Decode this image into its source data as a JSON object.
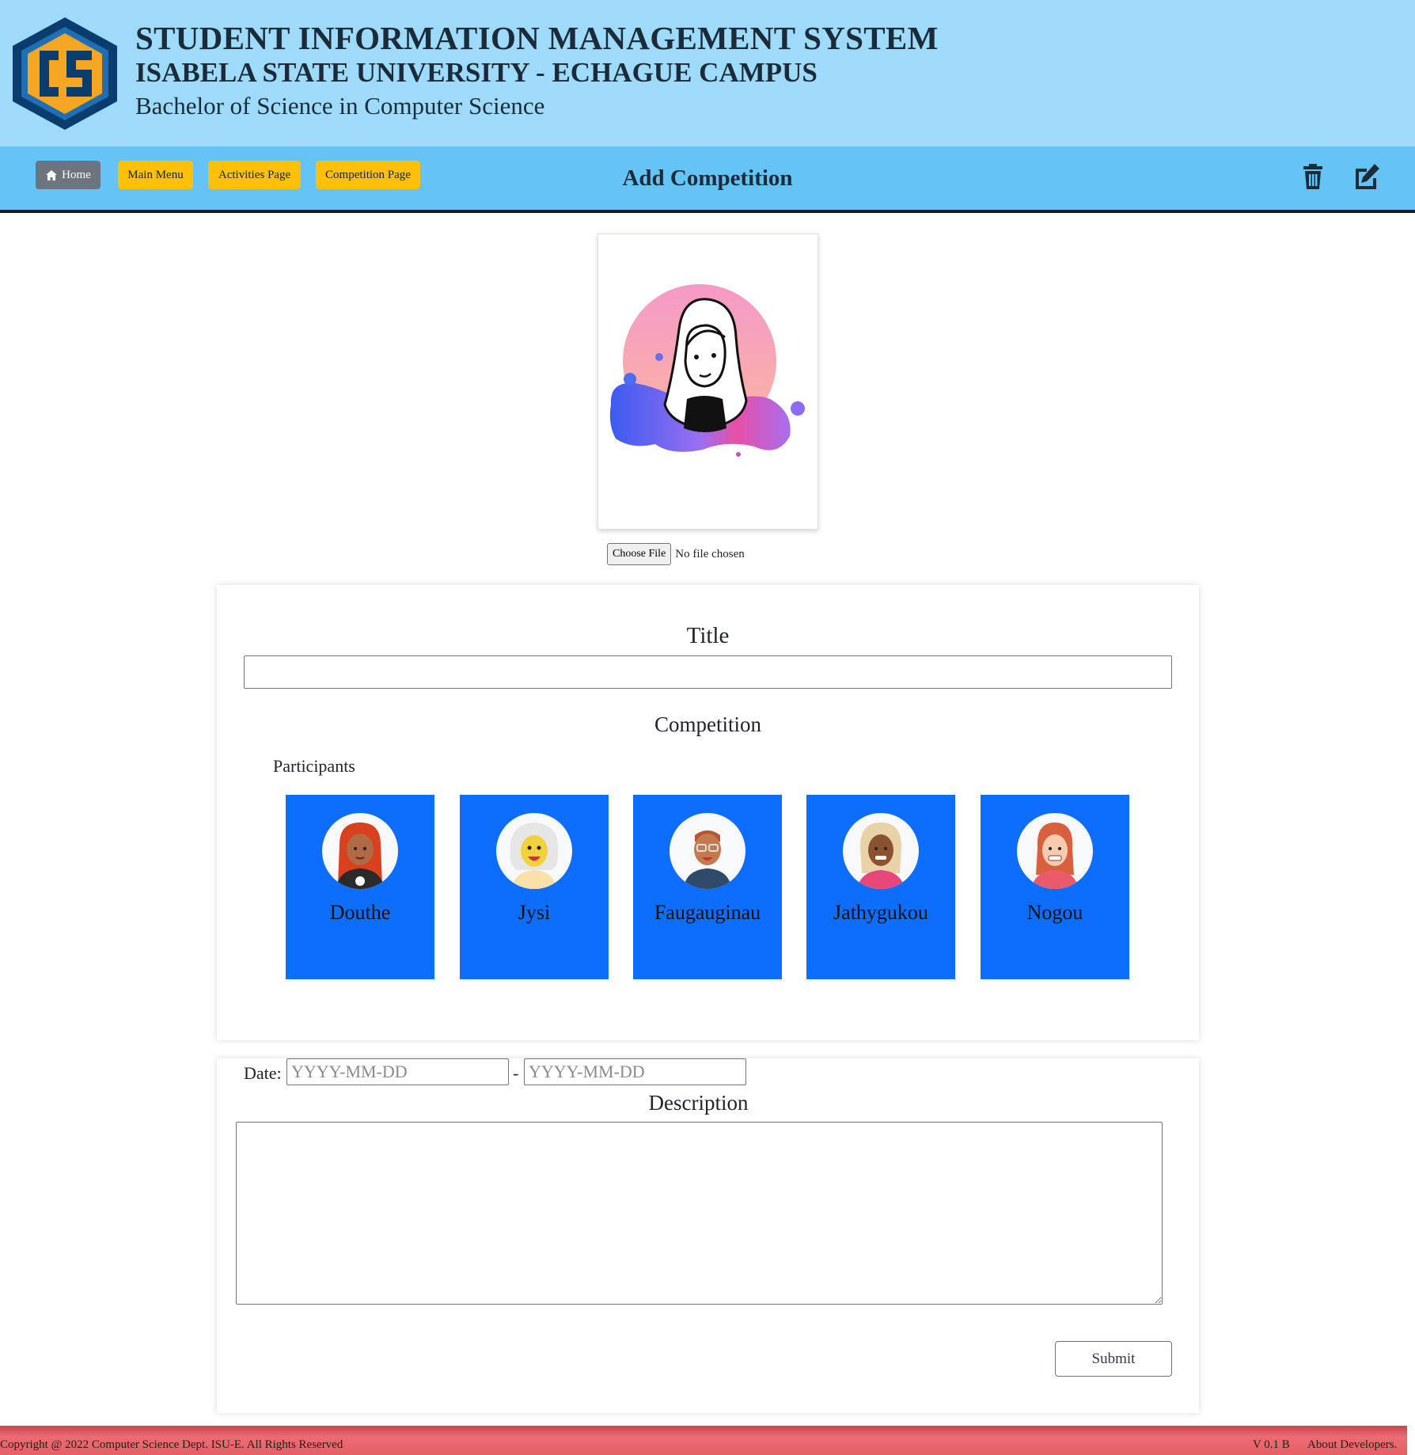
{
  "header": {
    "title": "STUDENT INFORMATION MANAGEMENT SYSTEM",
    "university": "ISABELA STATE UNIVERSITY - ECHAGUE CAMPUS",
    "program": "Bachelor of Science in Computer Science",
    "logo_icon": "cs-hexagon-logo"
  },
  "nav": {
    "home_label": "Home",
    "main_menu_label": "Main Menu",
    "activities_label": "Activities Page",
    "competition_label": "Competition Page",
    "page_title": "Add Competition",
    "delete_icon": "trash-icon",
    "edit_icon": "edit-icon"
  },
  "upload": {
    "choose_file_label": "Choose File",
    "file_status": "No file chosen"
  },
  "form": {
    "title_label": "Title",
    "title_value": "",
    "competition_label": "Competition",
    "participants_label": "Participants",
    "participants": [
      {
        "name": "Douthe"
      },
      {
        "name": "Jysi"
      },
      {
        "name": "Faugauginau"
      },
      {
        "name": "Jathygukou"
      },
      {
        "name": "Nogou"
      }
    ],
    "date_label": "Date:",
    "date_separator": "-",
    "date_from_placeholder": "YYYY-MM-DD",
    "date_to_placeholder": "YYYY-MM-DD",
    "description_label": "Description",
    "description_value": "",
    "submit_label": "Submit"
  },
  "footer": {
    "copyright": "Copyright @ 2022 Computer Science Dept. ISU-E. All Rights Reserved",
    "version": "V 0.1 B",
    "about": "About Developers."
  },
  "colors": {
    "header_bg": "#9edbfb",
    "nav_bg": "#66c3f5",
    "participant_bg": "#0d6efd",
    "yellow_button": "#ffc107",
    "gray_button": "#6c757d",
    "footer_bg": "#e55f66"
  }
}
